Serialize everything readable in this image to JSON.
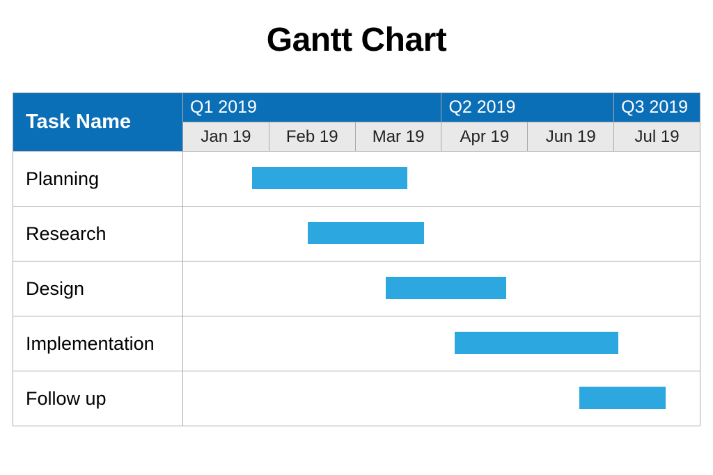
{
  "title": "Gantt Chart",
  "header_label": "Task Name",
  "quarters": [
    {
      "label": "Q1 2019",
      "span": 3
    },
    {
      "label": "Q2 2019",
      "span": 2
    },
    {
      "label": "Q3 2019",
      "span": 1
    }
  ],
  "months": [
    "Jan 19",
    "Feb 19",
    "Mar 19",
    "Apr 19",
    "Jun 19",
    "Jul 19"
  ],
  "tasks": [
    {
      "name": "Planning"
    },
    {
      "name": "Research"
    },
    {
      "name": "Design"
    },
    {
      "name": "Implementation"
    },
    {
      "name": "Follow up"
    }
  ],
  "chart_data": {
    "type": "gantt",
    "title": "Gantt Chart",
    "x_axis": {
      "quarters": [
        "Q1 2019",
        "Q2 2019",
        "Q3 2019"
      ],
      "months": [
        "Jan 19",
        "Feb 19",
        "Mar 19",
        "Apr 19",
        "Jun 19",
        "Jul 19"
      ]
    },
    "bars": [
      {
        "task": "Planning",
        "start_month_index": 0,
        "start_fraction": 0.8,
        "end_month_index": 2,
        "end_fraction": 0.6
      },
      {
        "task": "Research",
        "start_month_index": 1,
        "start_fraction": 0.45,
        "end_month_index": 2,
        "end_fraction": 0.8
      },
      {
        "task": "Design",
        "start_month_index": 2,
        "start_fraction": 0.35,
        "end_month_index": 3,
        "end_fraction": 0.75
      },
      {
        "task": "Implementation",
        "start_month_index": 3,
        "start_fraction": 0.15,
        "end_month_index": 5,
        "end_fraction": 0.05
      },
      {
        "task": "Follow up",
        "start_month_index": 4,
        "start_fraction": 0.6,
        "end_month_index": 5,
        "end_fraction": 0.6
      }
    ],
    "bar_color": "#2ca7df",
    "header_color": "#0b6fb8",
    "month_bg": "#e9e9e9"
  }
}
